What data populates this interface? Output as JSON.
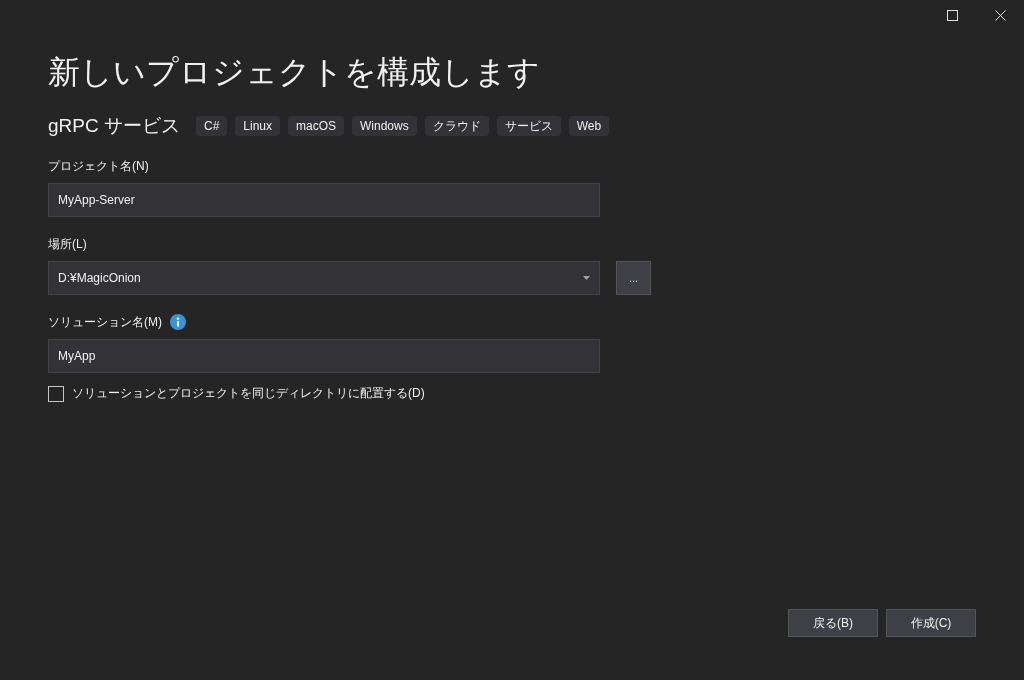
{
  "window": {
    "title": "新しいプロジェクトを構成します"
  },
  "template": {
    "name": "gRPC サービス",
    "tags": [
      "C#",
      "Linux",
      "macOS",
      "Windows",
      "クラウド",
      "サービス",
      "Web"
    ]
  },
  "fields": [
    {
      "kind": "text",
      "label": "プロジェクト名(N)",
      "value": "MyApp-Server"
    },
    {
      "kind": "dropdown",
      "label": "場所(L)",
      "value": "D:¥MagicOnion",
      "browse": "..."
    },
    {
      "kind": "text",
      "label": "ソリューション名(M)",
      "value": "MyApp",
      "info": true
    }
  ],
  "checkbox": {
    "label": "ソリューションとプロジェクトを同じディレクトリに配置する(D)",
    "checked": false
  },
  "buttons": [
    "戻る(B)",
    "作成(C)"
  ]
}
